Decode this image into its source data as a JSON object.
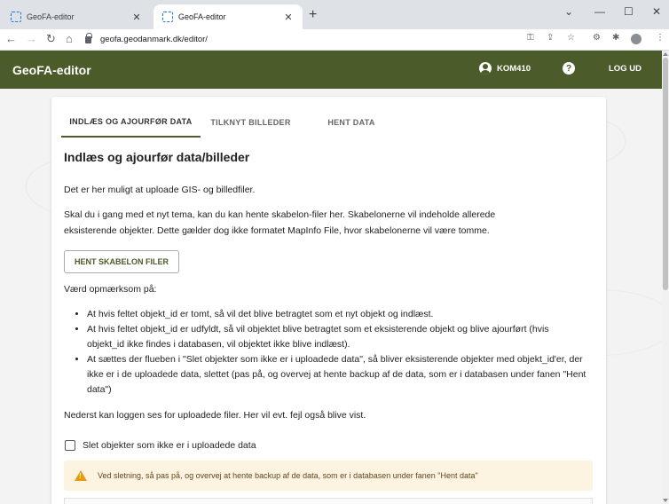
{
  "browser": {
    "tabs": [
      {
        "title": "GeoFA-editor",
        "active": false
      },
      {
        "title": "GeoFA-editor",
        "active": true
      }
    ],
    "new_tab": "+",
    "controls": {
      "minimize": "—",
      "maximize": "☐",
      "close": "✕",
      "tab_list": "⌄"
    },
    "nav": {
      "back": "←",
      "forward": "→",
      "reload": "↻",
      "home": "⌂"
    },
    "url": "geofa.geodanmark.dk/editor/",
    "toolbar_icons": {
      "key": "⚿",
      "share": "⇪",
      "star": "☆",
      "ext1": "⚙",
      "puzzle": "✱",
      "menu": "⋮"
    }
  },
  "app": {
    "brand": "GeoFA-editor",
    "user_label": "KOM410",
    "help": "?",
    "logout": "LOG UD"
  },
  "tabs": [
    {
      "label": "INDLÆS OG AJOURFØR DATA",
      "active": true
    },
    {
      "label": "TILKNYT BILLEDER",
      "active": false
    },
    {
      "label": "HENT DATA",
      "active": false
    }
  ],
  "content": {
    "title": "Indlæs og ajourfør data/billeder",
    "p1": "Det er her muligt at uploade GIS- og billedfiler.",
    "p2_line1": "Skal du i gang med et nyt tema, kan du kan hente skabelon-filer her. Skabelonerne vil indeholde allerede",
    "p2_line2": "eksisterende objekter. Dette gælder dog ikke formatet MapInfo File, hvor skabelonerne vil være tomme.",
    "template_button": "HENT SKABELON FILER",
    "note_intro": "Værd opmærksom på:",
    "bullets": [
      "At hvis feltet objekt_id er tomt, så vil det blive betragtet som et nyt objekt og indlæst.",
      "At hvis feltet objekt_id er udfyldt, så vil objektet blive betragtet som et eksisterende objekt og blive ajourført (hvis objekt_id ikke findes i databasen, vil objektet ikke blive indlæst).",
      "At sættes der flueben i \"Slet objekter som ikke er i uploadede data\", så bliver eksisterende objekter med objekt_id'er, der ikke er i de uploadede data, slettet (pas på, og overvej at hente backup af de data, som er i databasen under fanen \"Hent data\")"
    ],
    "log_text": "Nederst kan loggen ses for uploadede filer. Her vil evt. fejl også blive vist.",
    "checkbox_label": "Slet objekter som ikke er i uploadede data",
    "alert_text": "Ved sletning, så pas på, og overvej at hente backup af de data, som er i databasen under fanen \"Hent data\""
  },
  "colors": {
    "appbar": "#4b5b2a",
    "alert_bg": "#fdf3e1",
    "warning": "#e49b0f"
  }
}
